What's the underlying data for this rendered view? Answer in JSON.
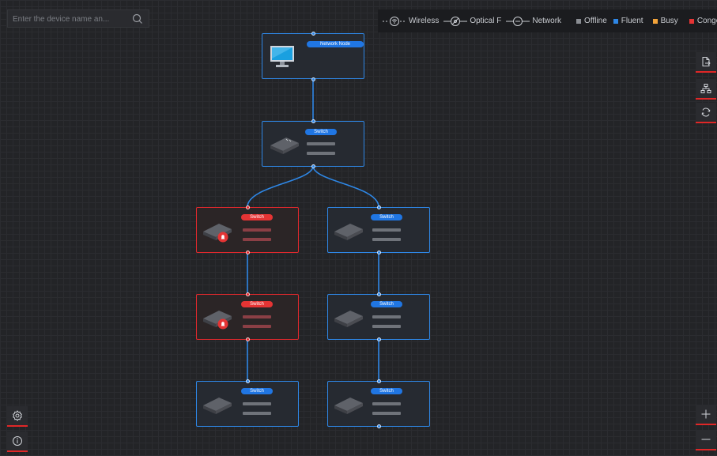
{
  "search": {
    "placeholder": "Enter the device name an..."
  },
  "legend": {
    "wireless": "Wireless",
    "optical": "Optical F",
    "network": "Network",
    "offline": "Offline",
    "fluent": "Fluent",
    "busy": "Busy",
    "congestion": "Congesti",
    "colors": {
      "offline": "#8a8d93",
      "fluent": "#2e87e6",
      "busy": "#f2a33a",
      "congestion": "#e53434"
    }
  },
  "nodes": {
    "root": {
      "label": "Network Node"
    },
    "switch_top": {
      "label": "Switch"
    },
    "switch_l1": {
      "label": "Switch"
    },
    "switch_r1": {
      "label": "Switch"
    },
    "switch_l2": {
      "label": "Switch"
    },
    "switch_r2": {
      "label": "Switch"
    },
    "switch_l3": {
      "label": "Switch"
    },
    "switch_r3": {
      "label": "Switch"
    }
  },
  "colors": {
    "accent": "#2e87e6",
    "alarm": "#e0282d"
  },
  "icons": {
    "search": "search-icon",
    "export": "export-icon",
    "topology": "topology-icon",
    "refresh": "refresh-icon",
    "settings": "settings-icon",
    "info": "info-icon",
    "zoom_in": "zoom-in-icon",
    "zoom_out": "zoom-out-icon"
  }
}
